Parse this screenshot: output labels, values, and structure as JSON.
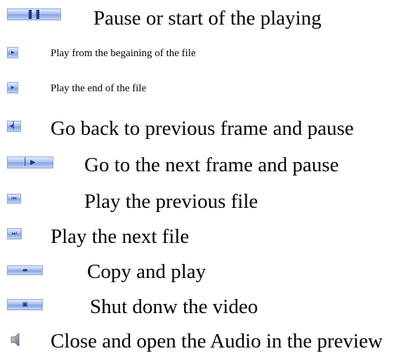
{
  "legend": {
    "items": [
      {
        "icon": "pause-icon",
        "label": "Pause or start of the playing"
      },
      {
        "icon": "play-from-beginning-icon",
        "label": "Play from the begaining of the file"
      },
      {
        "icon": "play-end-icon",
        "label": "Play the end of the file"
      },
      {
        "icon": "previous-frame-icon",
        "label": "Go back to previous frame and pause"
      },
      {
        "icon": "next-frame-icon",
        "label": "Go to the next frame and pause"
      },
      {
        "icon": "previous-file-icon",
        "label": "Play the previous file"
      },
      {
        "icon": "next-file-icon",
        "label": "Play the next file"
      },
      {
        "icon": "copy-play-icon",
        "label": "Copy and play"
      },
      {
        "icon": "shutdown-video-icon",
        "label": "Shut donw the video"
      },
      {
        "icon": "audio-icon",
        "label": "Close and open the Audio in the preview"
      }
    ]
  },
  "colors": {
    "button_light": "#e4ecfb",
    "button_dark": "#86a3df",
    "glyph": "#1f3a8a",
    "text": "#000000"
  }
}
